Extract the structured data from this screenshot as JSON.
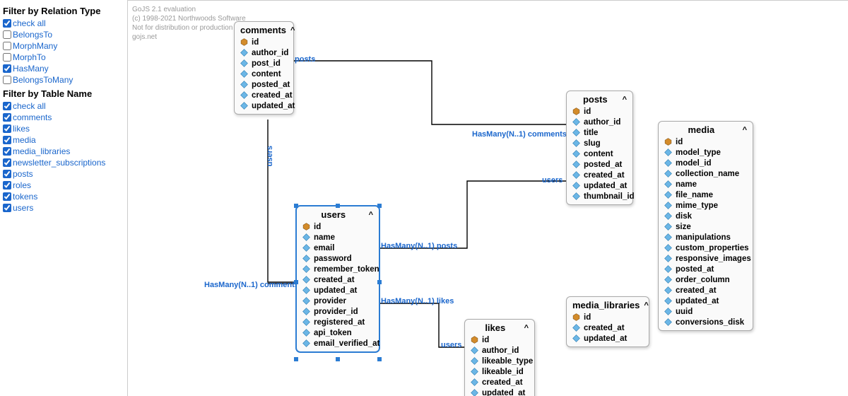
{
  "sidebar": {
    "relation_title": "Filter by Relation Type",
    "relation_items": [
      {
        "label": "check all",
        "checked": true
      },
      {
        "label": "BelongsTo",
        "checked": false
      },
      {
        "label": "MorphMany",
        "checked": false
      },
      {
        "label": "MorphTo",
        "checked": false
      },
      {
        "label": "HasMany",
        "checked": true
      },
      {
        "label": "BelongsToMany",
        "checked": false
      }
    ],
    "table_title": "Filter by Table Name",
    "table_items": [
      {
        "label": "check all",
        "checked": true
      },
      {
        "label": "comments",
        "checked": true
      },
      {
        "label": "likes",
        "checked": true
      },
      {
        "label": "media",
        "checked": true
      },
      {
        "label": "media_libraries",
        "checked": true
      },
      {
        "label": "newsletter_subscriptions",
        "checked": true
      },
      {
        "label": "posts",
        "checked": true
      },
      {
        "label": "roles",
        "checked": true
      },
      {
        "label": "tokens",
        "checked": true
      },
      {
        "label": "users",
        "checked": true
      }
    ]
  },
  "watermark": {
    "line1": "GoJS 2.1 evaluation",
    "line2": "(c) 1998-2021 Northwoods Software",
    "line3": "Not for distribution or production use",
    "line4": "gojs.net"
  },
  "link_labels": {
    "l0": "posts",
    "l1": "HasMany(N..1) comments",
    "l2": "users",
    "l3": "users",
    "l4": "HasMany(N..1) posts",
    "l5": "HasMany(N..1) likes",
    "l6": "HasMany(N..1) comments",
    "l7": "users"
  },
  "cards": {
    "comments": {
      "title": "comments",
      "caret": "^",
      "fields": [
        "id",
        "author_id",
        "post_id",
        "content",
        "posted_at",
        "created_at",
        "updated_at"
      ]
    },
    "users": {
      "title": "users",
      "caret": "^",
      "fields": [
        "id",
        "name",
        "email",
        "password",
        "remember_token",
        "created_at",
        "updated_at",
        "provider",
        "provider_id",
        "registered_at",
        "api_token",
        "email_verified_at"
      ]
    },
    "posts": {
      "title": "posts",
      "caret": "^",
      "fields": [
        "id",
        "author_id",
        "title",
        "slug",
        "content",
        "posted_at",
        "created_at",
        "updated_at",
        "thumbnail_id"
      ]
    },
    "likes": {
      "title": "likes",
      "caret": "^",
      "fields": [
        "id",
        "author_id",
        "likeable_type",
        "likeable_id",
        "created_at",
        "updated_at"
      ]
    },
    "media_libraries": {
      "title": "media_libraries",
      "caret": "^",
      "fields": [
        "id",
        "created_at",
        "updated_at"
      ]
    },
    "media": {
      "title": "media",
      "caret": "^",
      "fields": [
        "id",
        "model_type",
        "model_id",
        "collection_name",
        "name",
        "file_name",
        "mime_type",
        "disk",
        "size",
        "manipulations",
        "custom_properties",
        "responsive_images",
        "posted_at",
        "order_column",
        "created_at",
        "updated_at",
        "uuid",
        "conversions_disk"
      ]
    }
  }
}
